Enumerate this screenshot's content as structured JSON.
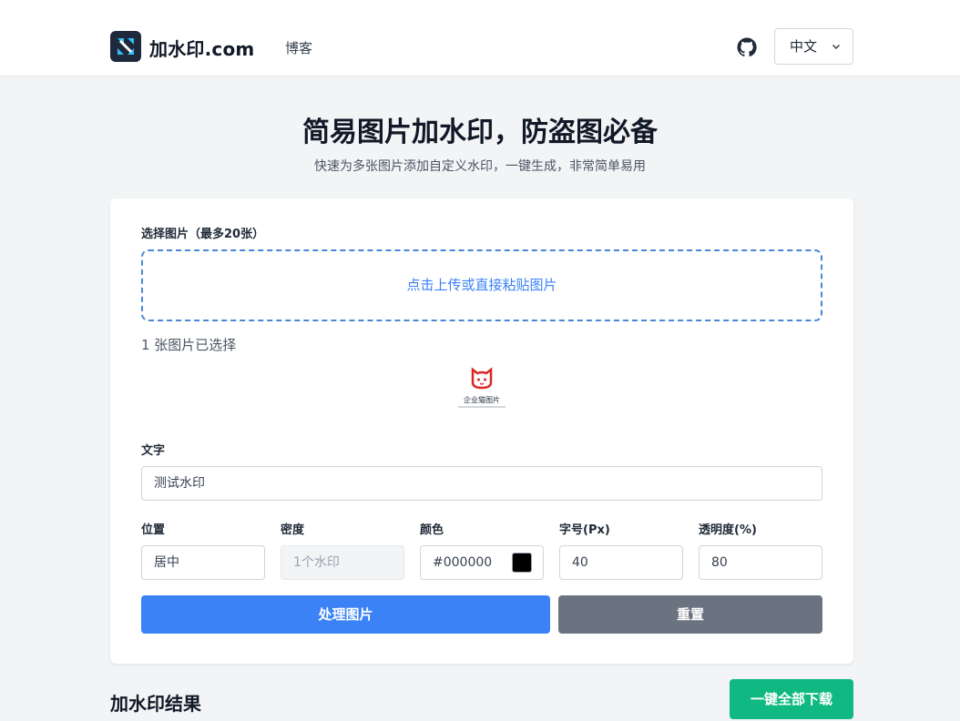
{
  "header": {
    "brand": "加水印.com",
    "nav_blog": "博客",
    "language": "中文",
    "icons": {
      "logo": "logo-icon",
      "github": "github-icon",
      "chevron": "chevron-down-icon"
    }
  },
  "hero": {
    "title": "简易图片加水印，防盗图必备",
    "subtitle": "快速为多张图片添加自定义水印，一键生成，非常简单易用"
  },
  "form": {
    "select_label": "选择图片（最多20张）",
    "dropzone_text": "点击上传或直接粘贴图片",
    "selected_count": "1 张图片已选择",
    "thumbnail_caption": "企业猫图片",
    "text_label": "文字",
    "text_value": "测试水印",
    "position_label": "位置",
    "position_value": "居中",
    "density_label": "密度",
    "density_value": "1个水印",
    "color_label": "颜色",
    "color_value": "#000000",
    "font_size_label": "字号(Px)",
    "font_size_value": "40",
    "opacity_label": "透明度(%)",
    "opacity_value": "80",
    "process_button": "处理图片",
    "reset_button": "重置"
  },
  "result": {
    "title": "加水印结果",
    "download_all": "一键全部下载"
  },
  "colors": {
    "primary": "#3b82f6",
    "reset": "#6b7280",
    "download": "#10b981",
    "dropzone_border": "#4a86d6",
    "watermark_color": "#000000"
  }
}
